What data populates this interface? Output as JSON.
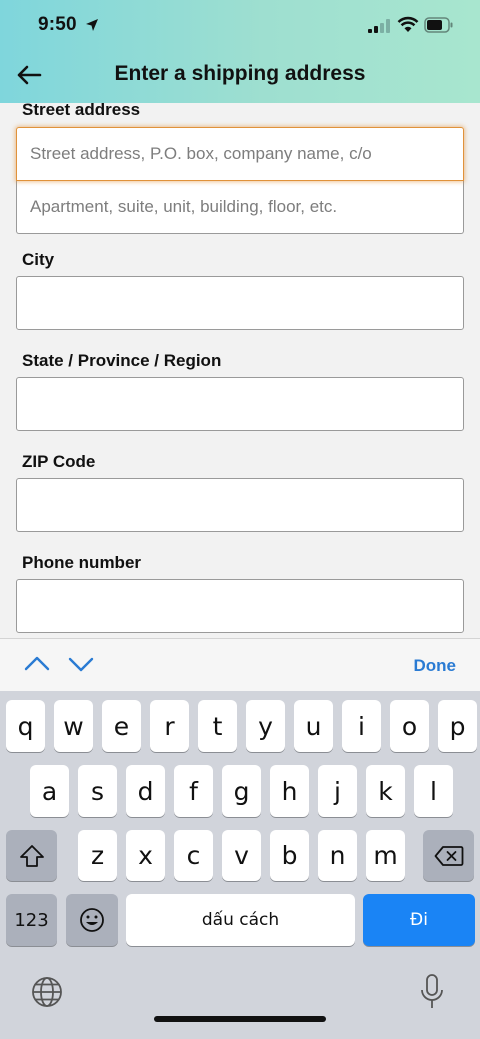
{
  "status_bar": {
    "time": "9:50"
  },
  "nav": {
    "title": "Enter a shipping address",
    "back_icon": "arrow-left-icon"
  },
  "form": {
    "street_label": "Street address",
    "street_placeholder": "Street address, P.O. box, company name, c/o",
    "apt_placeholder": "Apartment, suite, unit, building, floor, etc.",
    "city_label": "City",
    "state_label": "State / Province / Region",
    "zip_label": "ZIP Code",
    "phone_label": "Phone number"
  },
  "accessory": {
    "done_label": "Done"
  },
  "keyboard": {
    "row1": [
      "q",
      "w",
      "e",
      "r",
      "t",
      "y",
      "u",
      "i",
      "o",
      "p"
    ],
    "row2": [
      "a",
      "s",
      "d",
      "f",
      "g",
      "h",
      "j",
      "k",
      "l"
    ],
    "row3": [
      "z",
      "x",
      "c",
      "v",
      "b",
      "n",
      "m"
    ],
    "numbers_label": "123",
    "space_label": "dấu cách",
    "go_label": "Đi"
  },
  "colors": {
    "accent": "#2a7bd3",
    "focus_border": "#e0923a",
    "go_key": "#1a84f5"
  }
}
